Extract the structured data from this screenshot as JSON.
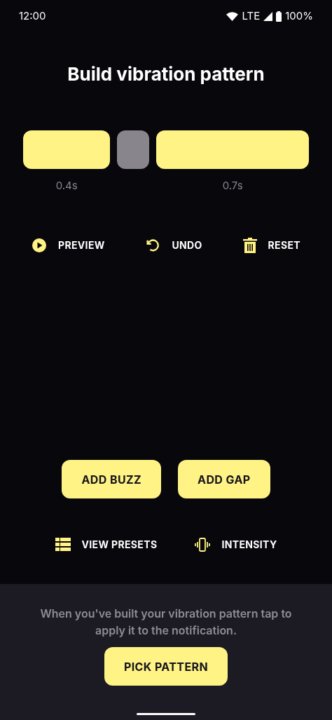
{
  "status_bar": {
    "time": "12:00",
    "network": "LTE",
    "battery": "100%"
  },
  "title": "Build vibration pattern",
  "pattern": [
    {
      "kind": "buzz",
      "duration": "0.4s"
    },
    {
      "kind": "gap"
    },
    {
      "kind": "buzz",
      "duration": "0.7s"
    }
  ],
  "actions": [
    {
      "kind": "play",
      "label": "PREVIEW"
    },
    {
      "kind": "undo",
      "label": "UNDO"
    },
    {
      "kind": "trash",
      "label": "RESET"
    }
  ],
  "add_buttons": [
    "ADD BUZZ",
    "ADD GAP"
  ],
  "links": [
    {
      "kind": "list",
      "label": "VIEW PRESETS"
    },
    {
      "kind": "vibrate",
      "label": "INTENSITY"
    }
  ],
  "footer": {
    "hint": "When you've built your vibration pattern tap to apply it to the notification.",
    "button": "PICK PATTERN"
  }
}
